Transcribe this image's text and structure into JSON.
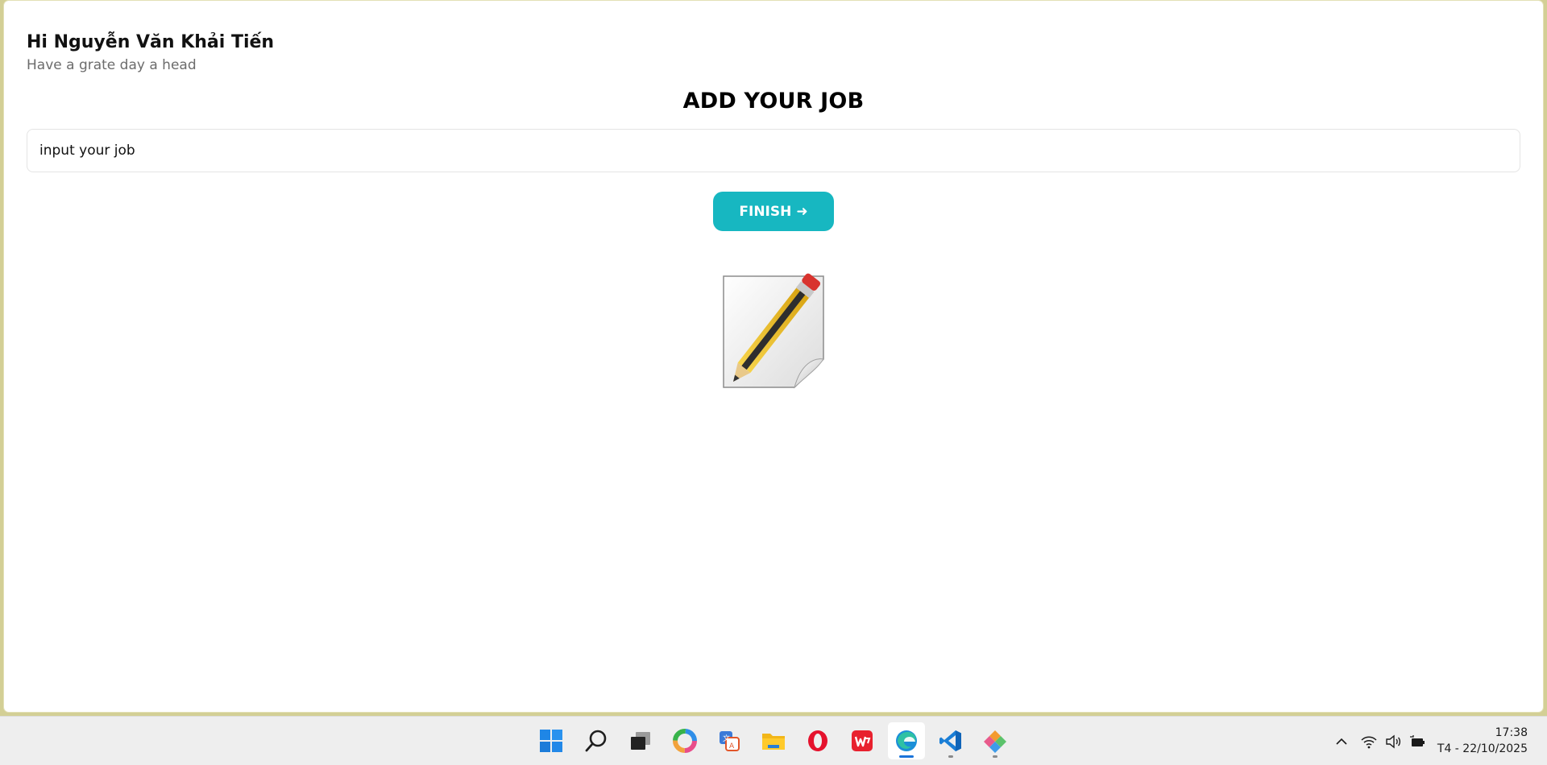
{
  "header": {
    "greeting": "Hi Nguyễn Văn Khải Tiến",
    "subtitle": "Have a grate day a head"
  },
  "main": {
    "title": "ADD YOUR JOB",
    "job_input": {
      "value": "input your job",
      "placeholder": ""
    },
    "finish_button": {
      "label": "FINISH",
      "arrow": "➜"
    },
    "illustration_icon": "document-pencil-icon"
  },
  "taskbar": {
    "apps": [
      {
        "name": "start-icon",
        "state": "idle"
      },
      {
        "name": "search-icon",
        "state": "idle"
      },
      {
        "name": "task-view-icon",
        "state": "idle"
      },
      {
        "name": "color-wheel-app-icon",
        "state": "idle"
      },
      {
        "name": "translator-app-icon",
        "state": "idle"
      },
      {
        "name": "file-explorer-icon",
        "state": "idle"
      },
      {
        "name": "opera-icon",
        "state": "idle"
      },
      {
        "name": "wps-office-icon",
        "state": "idle"
      },
      {
        "name": "edge-icon",
        "state": "focused"
      },
      {
        "name": "vscode-icon",
        "state": "running"
      },
      {
        "name": "git-app-icon",
        "state": "running"
      }
    ],
    "tray": {
      "icons": [
        "chevron-up-icon",
        "wifi-icon",
        "volume-icon",
        "battery-icon"
      ],
      "time": "17:38",
      "date": "T4 - 22/10/2025"
    }
  },
  "colors": {
    "accent": "#17b7c1",
    "desktop": "#d3cf95",
    "taskbar": "#eeeeee"
  }
}
